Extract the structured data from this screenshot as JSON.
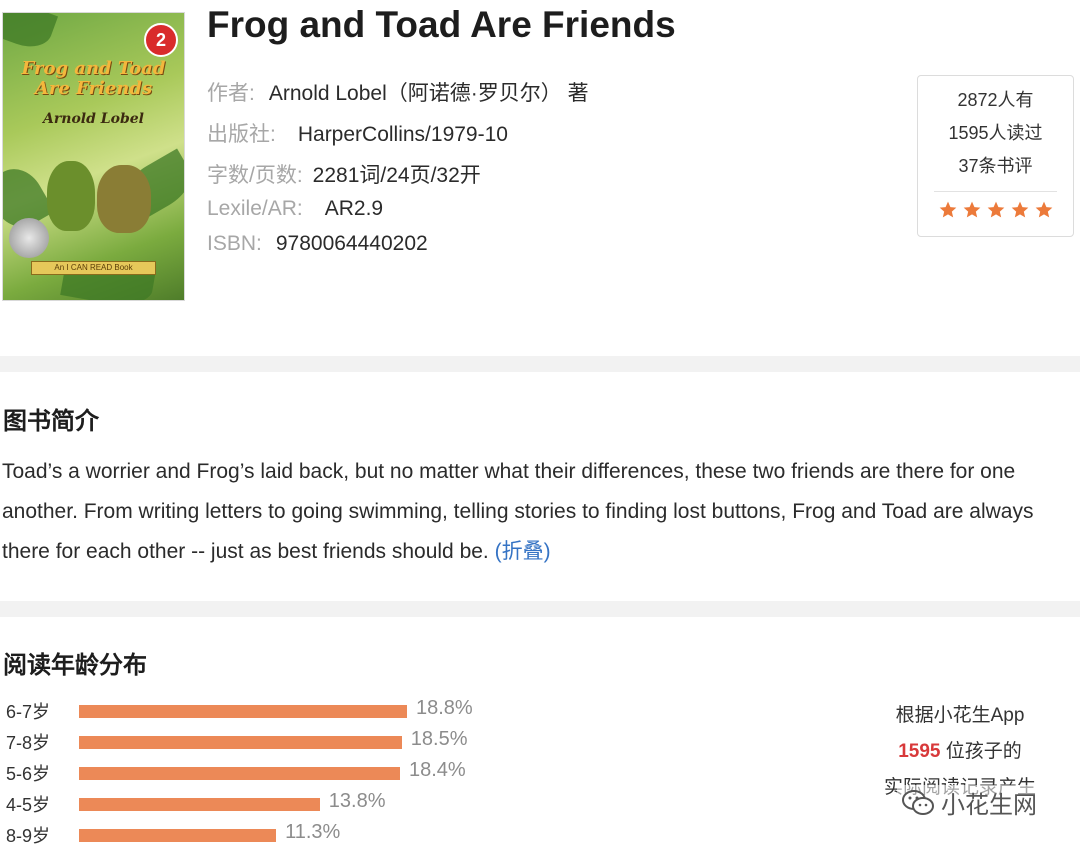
{
  "book": {
    "title": "Frog and Toad Are Friends",
    "cover": {
      "level_badge": "2",
      "title_line1": "Frog and Toad",
      "title_line2": "Are Friends",
      "author": "Arnold Lobel",
      "banner": "An I CAN READ Book"
    },
    "meta": [
      {
        "key": "作者:",
        "value": "Arnold Lobel（阿诺德·罗贝尔） 著"
      },
      {
        "key": "出版社:",
        "value": "HarperCollins/1979-10"
      },
      {
        "key": "字数/页数:",
        "value": "2281词/24页/32开"
      },
      {
        "key": "Lexile/AR:",
        "value": "AR2.9"
      },
      {
        "key": "ISBN:",
        "value": "9780064440202"
      }
    ],
    "stats": {
      "owned": "2872人有",
      "read": "1595人读过",
      "reviews": "37条书评",
      "rating_stars": 5,
      "star_color": "#ec7a3a"
    }
  },
  "intro": {
    "heading": "图书简介",
    "text": "Toad’s a worrier and Frog’s laid back, but no matter what their differences, these two friends are there for one another. From writing letters to going swimming, telling stories to finding lost buttons, Frog and Toad are always there for each other -- just as best friends should be. ",
    "fold_link": "(折叠)",
    "link_color": "#3573c4"
  },
  "age": {
    "heading": "阅读年龄分布",
    "bar_color": "#ec8957",
    "chart_data": {
      "type": "bar",
      "orientation": "horizontal",
      "categories": [
        "6-7岁",
        "7-8岁",
        "5-6岁",
        "4-5岁",
        "8-9岁"
      ],
      "values": [
        18.8,
        18.5,
        18.4,
        13.8,
        11.3
      ],
      "value_labels": [
        "18.8%",
        "18.5%",
        "18.4%",
        "13.8%",
        "11.3%"
      ],
      "unit": "%"
    },
    "note": {
      "line1": "根据小花生App",
      "count": "1595",
      "line2_suffix": " 位孩子的",
      "line3": "实际阅读记录产生"
    }
  },
  "watermark": {
    "text": "小花生网",
    "icon": "wechat-icon"
  }
}
